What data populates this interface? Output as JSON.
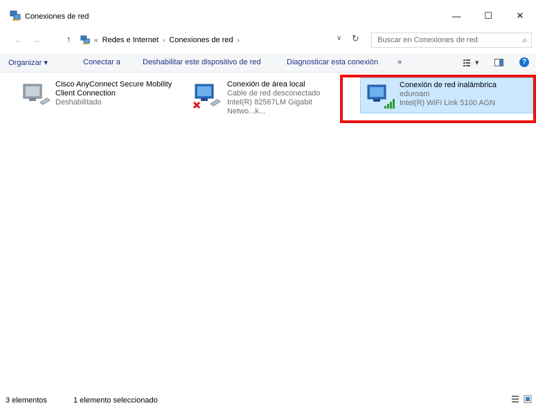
{
  "window": {
    "title": "Conexiones de red",
    "minimize_glyph": "—",
    "maximize_glyph": "☐",
    "close_glyph": "✕"
  },
  "address": {
    "back_glyph": "←",
    "forward_glyph": "→",
    "up_glyph": "↑",
    "overflow": "«",
    "crumbs": [
      "Redes e Internet",
      "Conexiones de red"
    ],
    "separator": "›",
    "dropdown_glyph": "∨",
    "refresh_glyph": "↻"
  },
  "search": {
    "placeholder": "Buscar en Conexiones de red",
    "icon_glyph": "⌕"
  },
  "toolbar": {
    "organize": "Organizar ▾",
    "connect": "Conectar a",
    "disable": "Deshabilitar este dispositivo de red",
    "diagnose": "Diagnosticar esta conexión",
    "more": "»",
    "change_view": "▾",
    "help": "?"
  },
  "items": [
    {
      "name_line1": "Cisco AnyConnect Secure Mobility",
      "name_line2": "Client Connection",
      "status": "Deshabilitado",
      "adapter": ""
    },
    {
      "name_line1": "Conexión de área local",
      "status": "Cable de red desconectado",
      "adapter": "Intel(R) 82567LM Gigabit Netwo...k..."
    },
    {
      "name_line1": "Conexión de red inalámbrica",
      "status": "eduroam",
      "adapter": "Intel(R) WiFi Link 5100 AGN",
      "selected": true
    }
  ],
  "status_bar": {
    "count": "3 elementos",
    "selection": "1 elemento seleccionado"
  },
  "colors": {
    "selection_bg": "#cce8ff",
    "highlight_border": "#ee1111",
    "toolbar_text": "#1e3287"
  }
}
